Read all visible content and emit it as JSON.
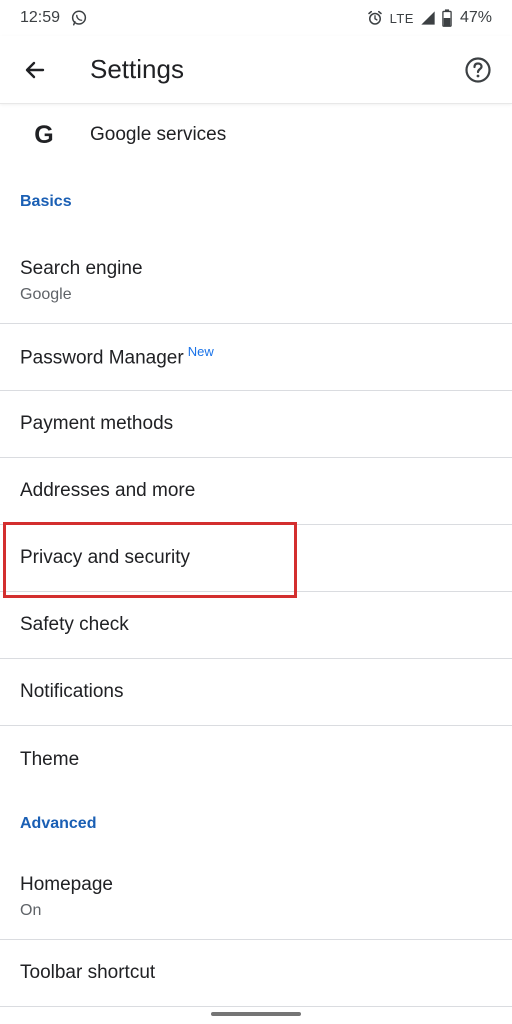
{
  "status_bar": {
    "time": "12:59",
    "network": "LTE",
    "battery_pct": "47%",
    "icons": [
      "whatsapp-icon",
      "alarm-icon",
      "signal-icon",
      "battery-icon"
    ]
  },
  "app_bar": {
    "title": "Settings",
    "back_icon": "back-arrow-icon",
    "help_icon": "help-icon"
  },
  "google_services": {
    "label": "Google services",
    "logo": "G"
  },
  "basics": {
    "header": "Basics",
    "items": [
      {
        "label": "Search engine",
        "sub": "Google"
      },
      {
        "label": "Password Manager",
        "badge": "New"
      },
      {
        "label": "Payment methods"
      },
      {
        "label": "Addresses and more"
      },
      {
        "label": "Privacy and security",
        "highlighted": true
      },
      {
        "label": "Safety check"
      },
      {
        "label": "Notifications"
      },
      {
        "label": "Theme"
      }
    ]
  },
  "advanced": {
    "header": "Advanced",
    "items": [
      {
        "label": "Homepage",
        "sub": "On"
      },
      {
        "label": "Toolbar shortcut"
      }
    ]
  },
  "colors": {
    "section_header": "#1a5fb4",
    "highlight_border": "#d32f2f",
    "new_badge": "#1a73e8",
    "divider": "#dadce0"
  }
}
